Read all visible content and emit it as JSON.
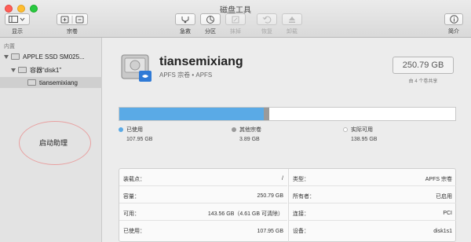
{
  "window": {
    "title": "磁盘工具"
  },
  "toolbar": {
    "view_label": "显示",
    "volume_label": "宗卷",
    "items": [
      {
        "label": "急救",
        "enabled": true
      },
      {
        "label": "分区",
        "enabled": true
      },
      {
        "label": "抹掉",
        "enabled": false
      },
      {
        "label": "恢复",
        "enabled": false
      },
      {
        "label": "卸载",
        "enabled": false
      }
    ],
    "info_label": "简介"
  },
  "sidebar": {
    "section": "内置",
    "disk": "APPLE SSD SM025...",
    "container": "容器“disk1”",
    "volume": "tiansemixiang",
    "overlay_text": "启动助理"
  },
  "volume": {
    "name": "tiansemixiang",
    "subtitle": "APFS 宗卷 • APFS",
    "size": "250.79 GB",
    "share_text": "由 4 个卷共享"
  },
  "usage": {
    "used_fraction": 0.43,
    "other_fraction": 0.016,
    "colors": {
      "used": "#5aaae6",
      "other": "#9a9a9a",
      "free": "#ffffff"
    },
    "legend": [
      {
        "label": "已使用",
        "value": "107.95 GB"
      },
      {
        "label": "其他宗卷",
        "value": "3.89 GB"
      },
      {
        "label": "实际可用",
        "value": "138.95 GB"
      }
    ]
  },
  "details": {
    "left": [
      {
        "k": "装载点：",
        "v": "/"
      },
      {
        "k": "容量：",
        "v": "250.79 GB"
      },
      {
        "k": "可用：",
        "v": "143.56 GB（4.61 GB 可清除）"
      },
      {
        "k": "已使用：",
        "v": "107.95 GB"
      }
    ],
    "right": [
      {
        "k": "类型：",
        "v": "APFS 宗卷"
      },
      {
        "k": "所有者：",
        "v": "已启用"
      },
      {
        "k": "连接：",
        "v": "PCI"
      },
      {
        "k": "设备：",
        "v": "disk1s1"
      }
    ]
  }
}
